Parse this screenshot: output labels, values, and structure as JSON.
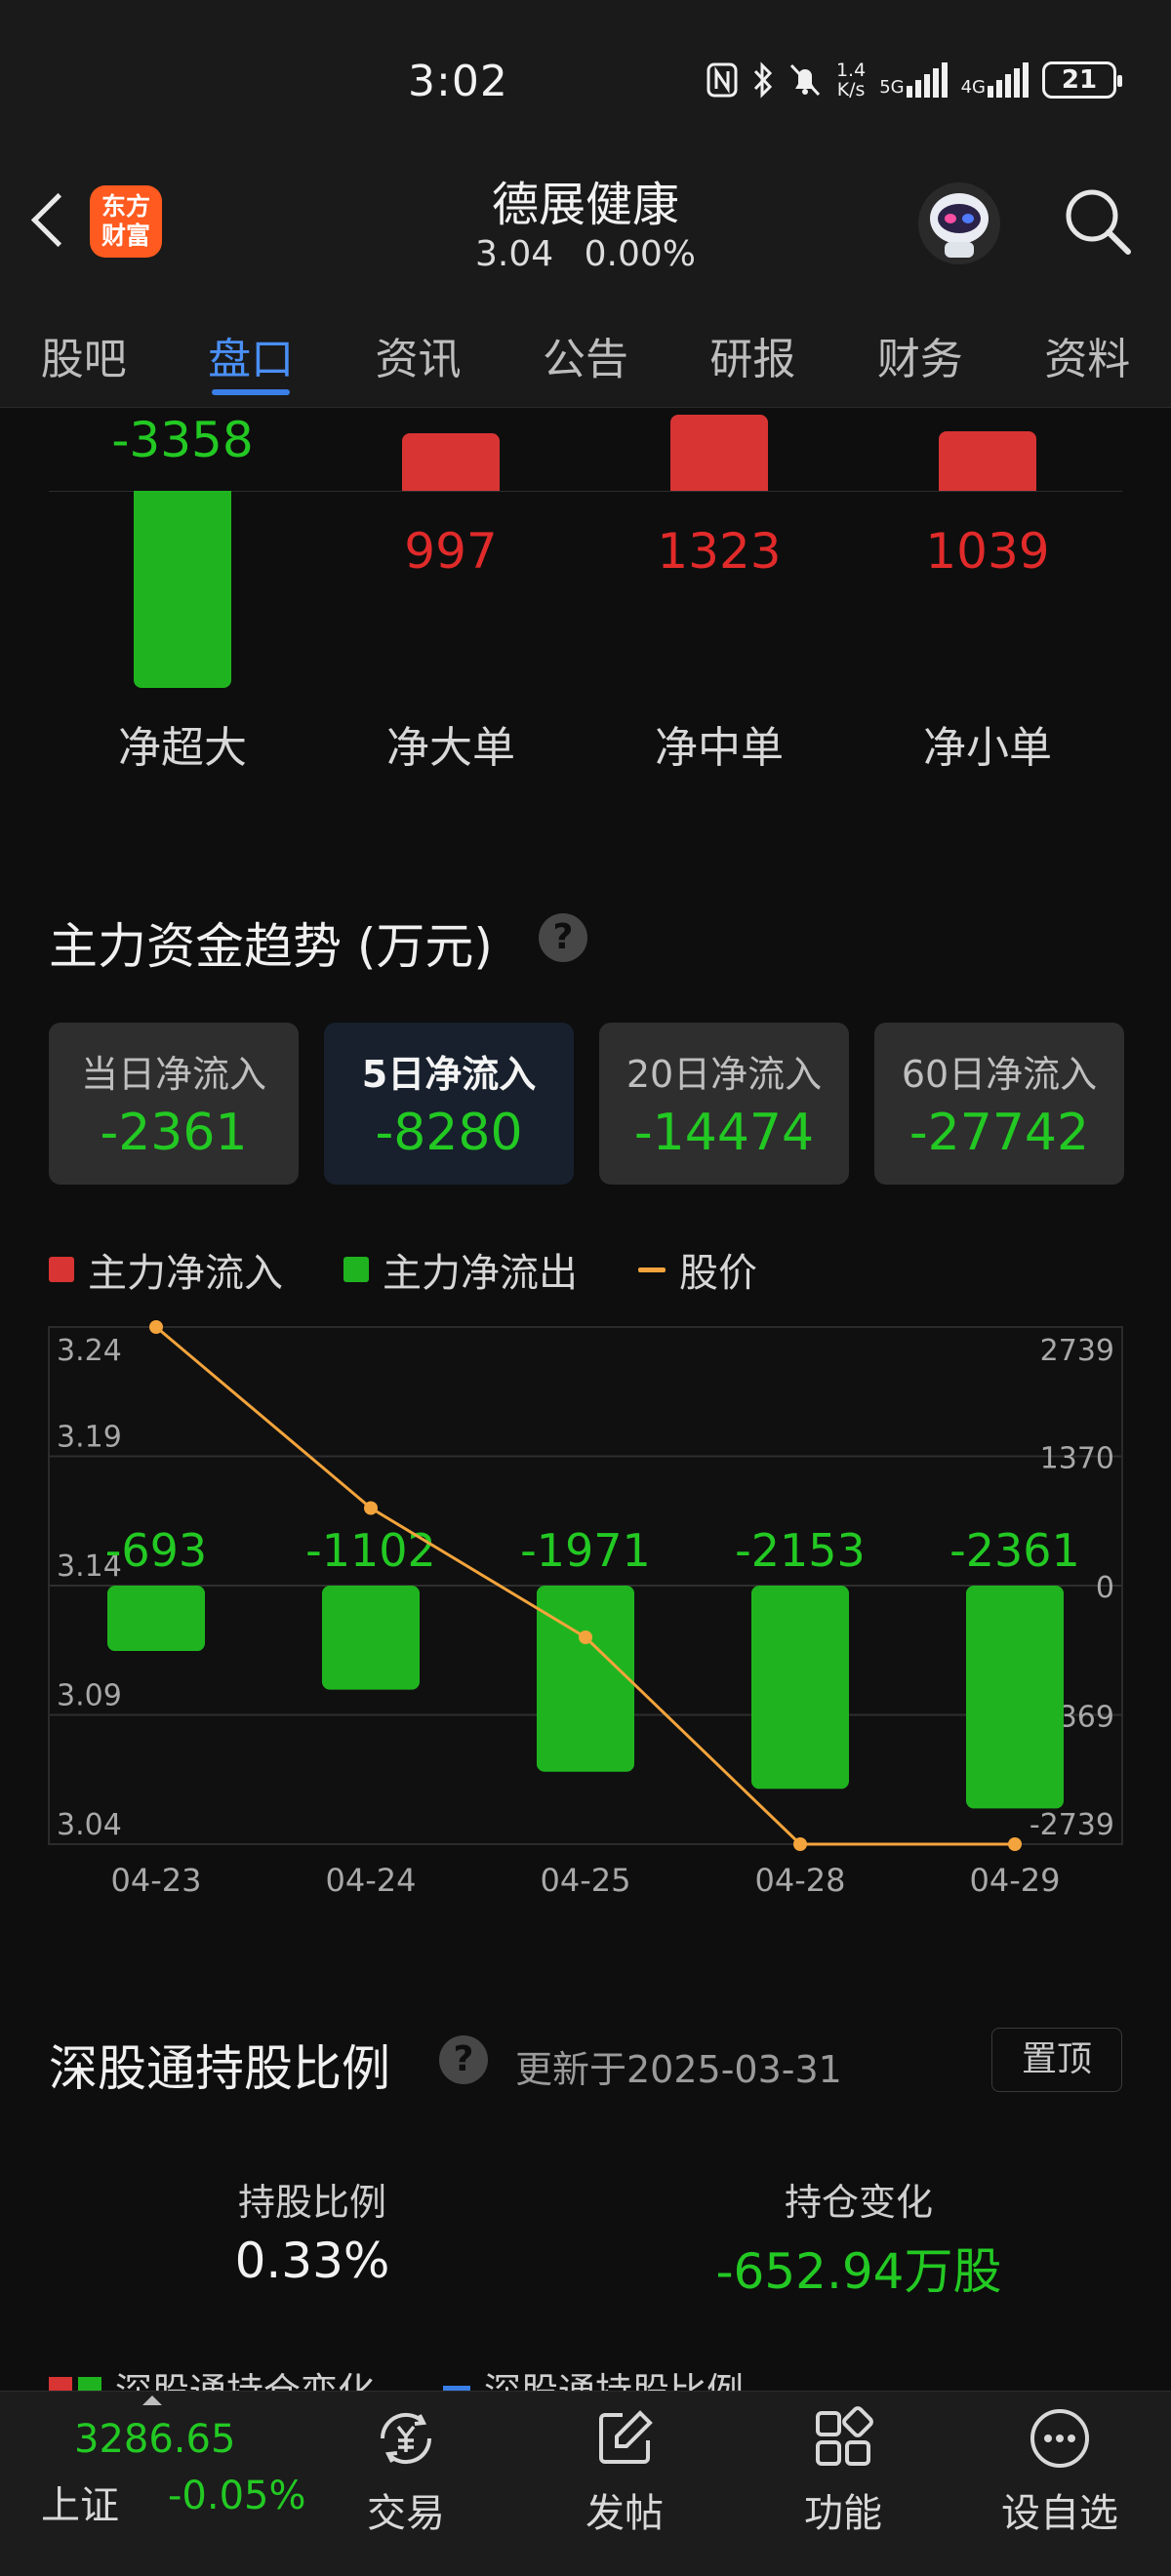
{
  "status_bar": {
    "time": "3:02",
    "net_speed_value": "1.4",
    "net_speed_unit": "K/s",
    "sim1_type": "5G",
    "sim2_type": "4G",
    "battery": "21",
    "icons": [
      "nfc-icon",
      "bluetooth-icon",
      "mute-icon",
      "signal-icon",
      "battery-icon"
    ]
  },
  "header": {
    "logo_line1": "东方",
    "logo_line2": "财富",
    "stock_name": "德展健康",
    "price": "3.04",
    "change_pct": "0.00%"
  },
  "tabs": [
    {
      "label": "股吧",
      "active": false
    },
    {
      "label": "盘口",
      "active": true
    },
    {
      "label": "资讯",
      "active": false
    },
    {
      "label": "公告",
      "active": false
    },
    {
      "label": "研报",
      "active": false
    },
    {
      "label": "财务",
      "active": false
    },
    {
      "label": "资料",
      "active": false
    }
  ],
  "net_flow": {
    "items": [
      {
        "label": "净超大",
        "value": "-3358"
      },
      {
        "label": "净大单",
        "value": "997"
      },
      {
        "label": "净中单",
        "value": "1323"
      },
      {
        "label": "净小单",
        "value": "1039"
      }
    ],
    "values_num": [
      -3358,
      997,
      1323,
      1039
    ]
  },
  "trend": {
    "title": "主力资金趋势 (万元)",
    "help": "?",
    "cards": [
      {
        "label": "当日净流入",
        "value": "-2361",
        "selected": false
      },
      {
        "label": "5日净流入",
        "value": "-8280",
        "selected": true
      },
      {
        "label": "20日净流入",
        "value": "-14474",
        "selected": false
      },
      {
        "label": "60日净流入",
        "value": "-27742",
        "selected": false
      }
    ],
    "legend": [
      {
        "label": "主力净流入",
        "color": "#d83434"
      },
      {
        "label": "主力净流出",
        "color": "#1fb41f"
      },
      {
        "label": "股价",
        "color": "#f4a43c"
      }
    ]
  },
  "chart_data": {
    "type": "bar",
    "categories": [
      "04-23",
      "04-24",
      "04-25",
      "04-28",
      "04-29"
    ],
    "series": [
      {
        "name": "主力净流出",
        "type": "bar",
        "values": [
          -693,
          -1102,
          -1971,
          -2153,
          -2361
        ],
        "labels": [
          "-693",
          "-1102",
          "-1971",
          "-2153",
          "-2361"
        ]
      },
      {
        "name": "股价",
        "type": "line",
        "values": [
          3.24,
          3.17,
          3.12,
          3.04,
          3.04
        ]
      }
    ],
    "y_left_ticks": [
      "3.24",
      "3.19",
      "3.14",
      "3.09",
      "3.04"
    ],
    "y_left_range": [
      3.04,
      3.24
    ],
    "y_right_ticks": [
      "2739",
      "1370",
      "0",
      "-1369",
      "-2739"
    ],
    "y_right_range": [
      -2739,
      2739
    ],
    "grid": true
  },
  "hk": {
    "title": "深股通持股比例",
    "help": "?",
    "updated": "更新于2025-03-31",
    "pin_label": "置顶",
    "ratio_label": "持股比例",
    "ratio_value": "0.33%",
    "change_label": "持仓变化",
    "change_value": "-652.94万股",
    "legend_change": "深股通持仓变化",
    "legend_ratio": "深股通持股比例"
  },
  "bottom_nav": {
    "index_value": "3286.65",
    "index_name": "上证",
    "index_pct": "-0.05%",
    "items": [
      {
        "label": "交易",
        "icon": "trade-yen-icon"
      },
      {
        "label": "发帖",
        "icon": "edit-post-icon"
      },
      {
        "label": "功能",
        "icon": "grid-apps-icon"
      },
      {
        "label": "设自选",
        "icon": "more-dots-icon"
      }
    ]
  }
}
